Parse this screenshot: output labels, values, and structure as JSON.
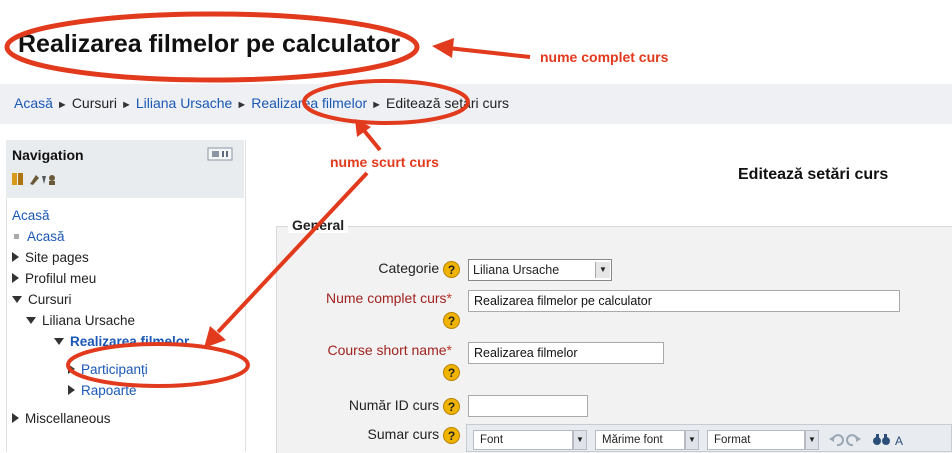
{
  "course_title": "Realizarea filmelor pe calculator",
  "breadcrumb": {
    "home": "Acasă",
    "courses": "Cursuri",
    "category": "Liliana Ursache",
    "course": "Realizarea filmelor",
    "current": "Editează setări curs",
    "separator": "►"
  },
  "navigation": {
    "title": "Navigation",
    "items": [
      {
        "label": "Acasă",
        "type": "link"
      },
      {
        "label": "Acasă",
        "type": "link"
      },
      {
        "label": "Site pages",
        "type": "collapsed"
      },
      {
        "label": "Profilul meu",
        "type": "collapsed"
      },
      {
        "label": "Cursuri",
        "type": "expanded"
      },
      {
        "label": "Liliana Ursache",
        "type": "expanded"
      },
      {
        "label": "Realizarea filmelor",
        "type": "current"
      },
      {
        "label": "Participanți",
        "type": "collapsed"
      },
      {
        "label": "Rapoarte",
        "type": "collapsed"
      },
      {
        "label": "Miscellaneous",
        "type": "collapsed"
      }
    ]
  },
  "form": {
    "heading": "Editează setări curs",
    "section_legend": "General",
    "fields": {
      "category_label": "Categorie",
      "category_value": "Liliana Ursache",
      "fullname_label": "Nume complet curs",
      "fullname_value": "Realizarea filmelor pe calculator",
      "shortname_label": "Course short name",
      "shortname_value": "Realizarea filmelor",
      "idnumber_label": "Număr ID curs",
      "idnumber_value": "",
      "summary_label": "Sumar curs",
      "required_mark": "*",
      "help_glyph": "?"
    },
    "editor_toolbar": {
      "font": "Font",
      "font_size": "Mărime font",
      "format": "Format"
    }
  },
  "annotations": {
    "full_name": "nume complet curs",
    "short_name": "nume scurt curs",
    "color": "#e23a1d"
  }
}
